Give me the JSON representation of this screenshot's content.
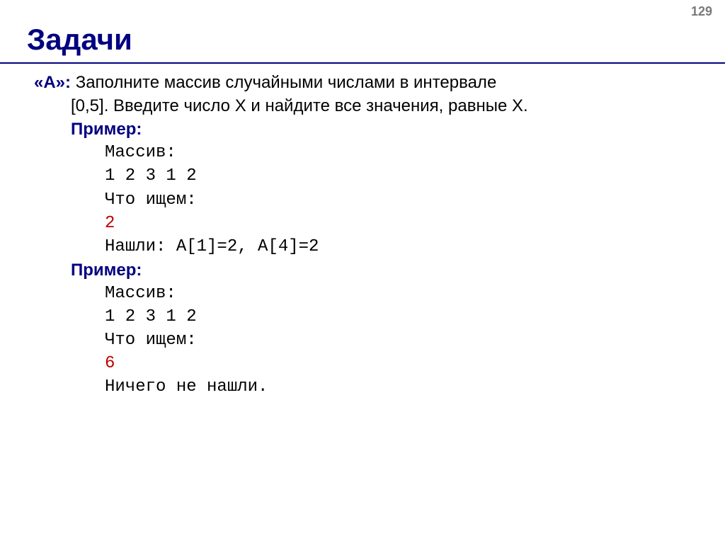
{
  "page_number": "129",
  "title": "Задачи",
  "task": {
    "label": "«A»:",
    "text_line1": " Заполните массив случайными числами в интервале",
    "text_line2": "[0,5]. Введите число X и найдите все значения, равные X."
  },
  "example1": {
    "label": "Пример:",
    "lines": {
      "l1": "Массив:",
      "l2": "1 2 3 1 2",
      "l3": "Что ищем:",
      "l4": "2",
      "l5": "Нашли: A[1]=2, A[4]=2"
    }
  },
  "example2": {
    "label": "Пример:",
    "lines": {
      "l1": "Массив:",
      "l2": "1 2 3 1 2",
      "l3": "Что ищем:",
      "l4": "6",
      "l5": "Ничего не нашли."
    }
  }
}
